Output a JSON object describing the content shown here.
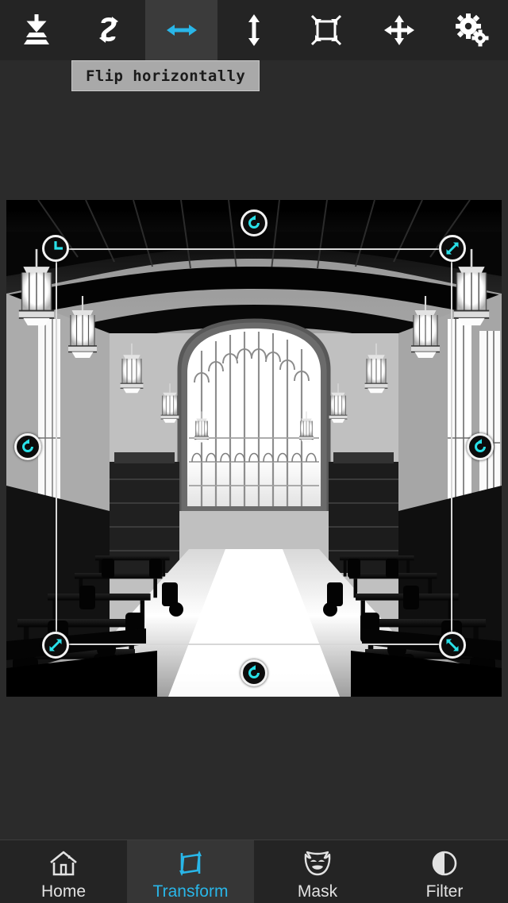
{
  "app": {
    "background_color": "#2b2b2b",
    "accent_color": "#29b6e8",
    "toolbar_color": "#242424"
  },
  "toolbar": {
    "items": [
      {
        "id": "flatten",
        "icon": "flatten-layers-icon",
        "label": "Flatten",
        "active": false,
        "color": "#ffffff"
      },
      {
        "id": "rotate",
        "icon": "rotate-swap-icon",
        "label": "Rotate",
        "active": false,
        "color": "#ffffff"
      },
      {
        "id": "flip-horizontal",
        "icon": "flip-horizontal-icon",
        "label": "Flip horizontally",
        "active": true,
        "color": "#29b6e8"
      },
      {
        "id": "flip-vertical",
        "icon": "flip-vertical-icon",
        "label": "Flip vertically",
        "active": false,
        "color": "#ffffff"
      },
      {
        "id": "crop",
        "icon": "crop-frame-icon",
        "label": "Crop",
        "active": false,
        "color": "#ffffff"
      },
      {
        "id": "move",
        "icon": "move-four-arrows-icon",
        "label": "Move",
        "active": false,
        "color": "#ffffff"
      },
      {
        "id": "settings",
        "icon": "gears-icon",
        "label": "Settings",
        "active": false,
        "color": "#ffffff"
      }
    ]
  },
  "tooltip": {
    "text": "Flip horizontally",
    "background_color": "#a9a9a9",
    "text_color": "#1b1b1b"
  },
  "canvas": {
    "image_description": "Black and white photograph of a gothic library reading room with a tall arched stained-glass window, hanging lanterns, timber beamed ceiling and rows of study tables",
    "selection": {
      "border_color": "#d7d7d7",
      "handles": [
        {
          "id": "top-left",
          "icon": "corner-angle-handle-icon",
          "position": "top-left"
        },
        {
          "id": "top-center",
          "icon": "rotate-handle-icon",
          "position": "top-center"
        },
        {
          "id": "top-right",
          "icon": "resize-diagonal-handle-icon",
          "position": "top-right"
        },
        {
          "id": "middle-left",
          "icon": "rotate-handle-icon",
          "position": "middle-left"
        },
        {
          "id": "middle-right",
          "icon": "rotate-handle-icon",
          "position": "middle-right"
        },
        {
          "id": "bottom-left",
          "icon": "resize-diagonal-handle-icon",
          "position": "bottom-left"
        },
        {
          "id": "bottom-center",
          "icon": "rotate-handle-icon",
          "position": "bottom-center"
        },
        {
          "id": "bottom-right",
          "icon": "resize-diagonal-handle-icon",
          "position": "bottom-right"
        }
      ]
    }
  },
  "bottom_nav": {
    "items": [
      {
        "id": "home",
        "label": "Home",
        "icon": "house-icon",
        "active": false
      },
      {
        "id": "transform",
        "label": "Transform",
        "icon": "transform-icon",
        "active": true
      },
      {
        "id": "mask",
        "label": "Mask",
        "icon": "theater-mask-icon",
        "active": false
      },
      {
        "id": "filter",
        "label": "Filter",
        "icon": "half-circle-icon",
        "active": false
      }
    ]
  }
}
